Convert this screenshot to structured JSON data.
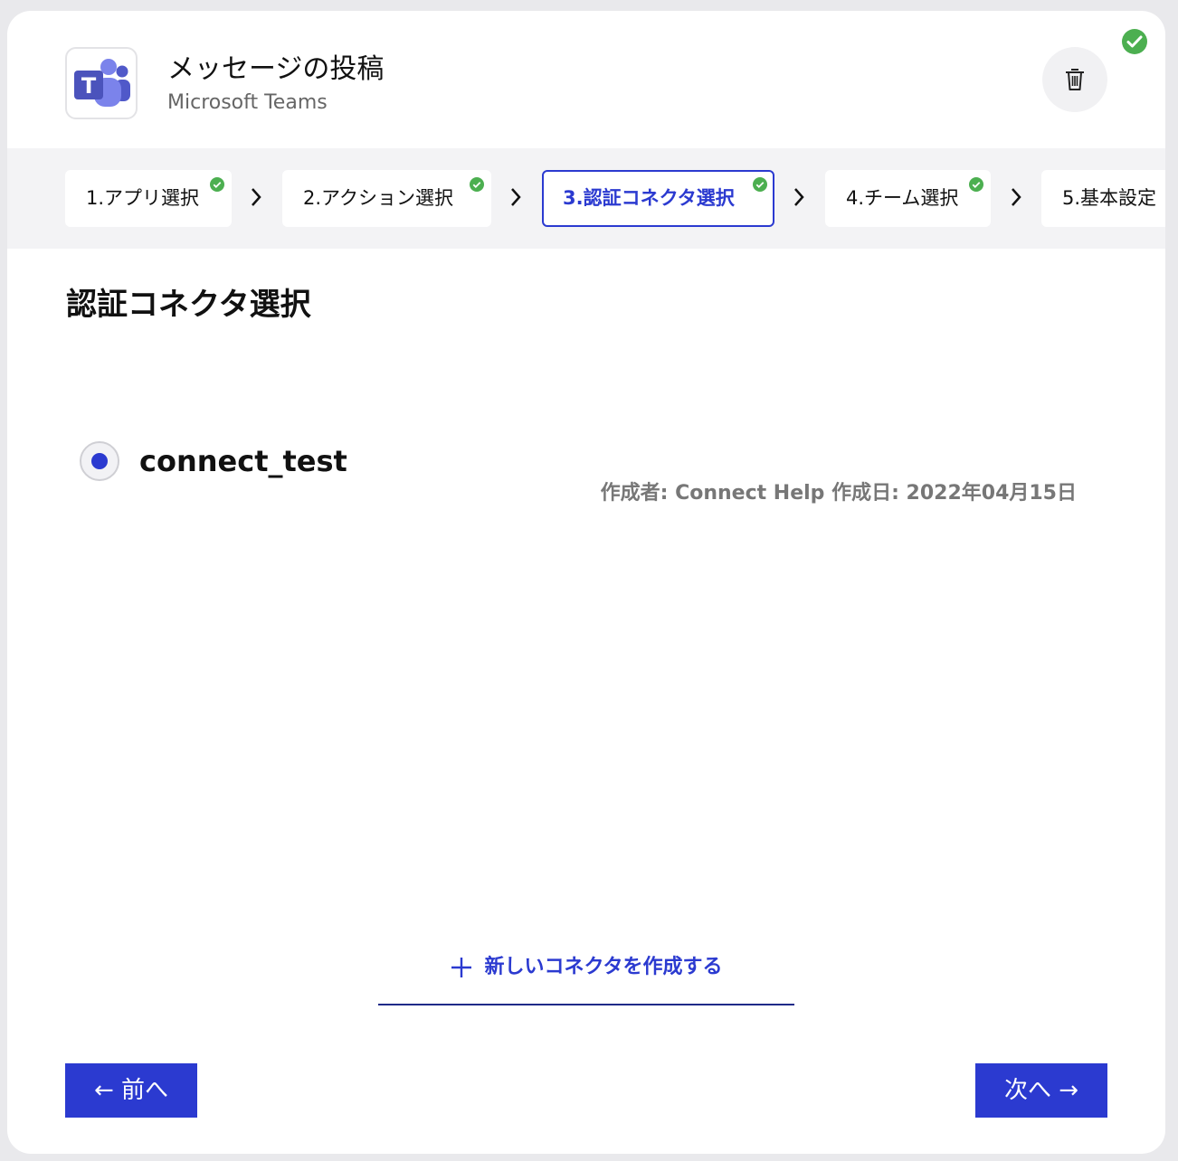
{
  "header": {
    "title": "メッセージの投稿",
    "subtitle": "Microsoft Teams",
    "app_icon": "microsoft-teams-logo",
    "delete_icon": "trash-icon",
    "status_icon": "check-circle-icon"
  },
  "steps": [
    {
      "label": "1.アプリ選択",
      "completed": true,
      "active": false
    },
    {
      "label": "2.アクション選択",
      "completed": true,
      "active": false
    },
    {
      "label": "3.認証コネクタ選択",
      "completed": true,
      "active": true
    },
    {
      "label": "4.チーム選択",
      "completed": true,
      "active": false
    },
    {
      "label": "5.基本設定",
      "completed": false,
      "active": false
    }
  ],
  "main": {
    "section_title": "認証コネクタ選択",
    "connectors": [
      {
        "name": "connect_test",
        "meta": "作成者: Connect Help 作成日: 2022年04月15日",
        "selected": true
      }
    ],
    "new_connector_label": "新しいコネクタを作成する"
  },
  "footer": {
    "prev_label": "← 前へ",
    "next_label": "次へ →"
  },
  "colors": {
    "accent": "#2b3ad0",
    "success": "#4caf50",
    "step_bar_bg": "#f3f3f5"
  }
}
